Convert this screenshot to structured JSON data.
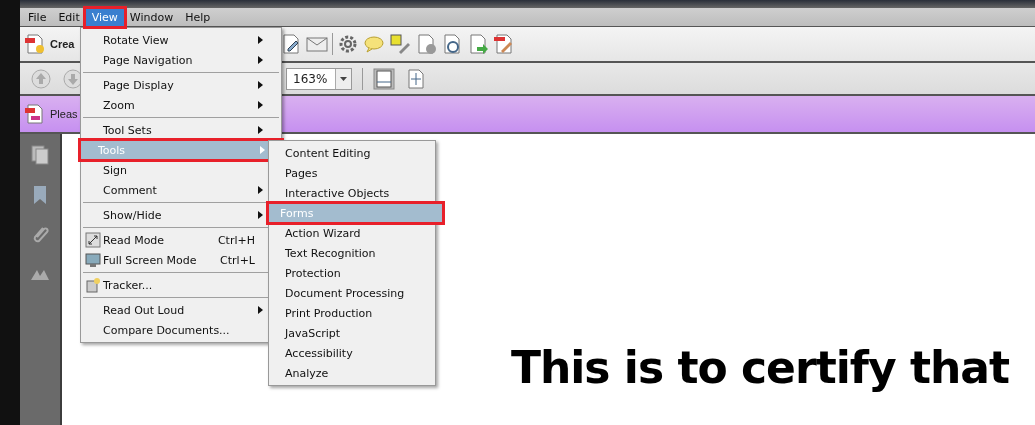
{
  "menubar": [
    {
      "label": "File",
      "selected": false,
      "outlined": false
    },
    {
      "label": "Edit",
      "selected": false,
      "outlined": false
    },
    {
      "label": "View",
      "selected": true,
      "outlined": true
    },
    {
      "label": "Window",
      "selected": false,
      "outlined": false
    },
    {
      "label": "Help",
      "selected": false,
      "outlined": false
    }
  ],
  "toolbar": {
    "create_label": "Crea",
    "zoom": "163%"
  },
  "notice": {
    "text": "Pleas"
  },
  "view_menu": [
    {
      "kind": "item",
      "label": "Rotate View",
      "submenu": true,
      "selected": false,
      "outlined": false
    },
    {
      "kind": "item",
      "label": "Page Navigation",
      "submenu": true,
      "selected": false,
      "outlined": false
    },
    {
      "kind": "separator"
    },
    {
      "kind": "item",
      "label": "Page Display",
      "submenu": true,
      "selected": false,
      "outlined": false
    },
    {
      "kind": "item",
      "label": "Zoom",
      "submenu": true,
      "selected": false,
      "outlined": false
    },
    {
      "kind": "separator"
    },
    {
      "kind": "item",
      "label": "Tool Sets",
      "submenu": true,
      "selected": false,
      "outlined": false
    },
    {
      "kind": "item",
      "label": "Tools",
      "submenu": true,
      "selected": true,
      "outlined": true
    },
    {
      "kind": "item",
      "label": "Sign",
      "submenu": false,
      "selected": false,
      "outlined": false
    },
    {
      "kind": "item",
      "label": "Comment",
      "submenu": true,
      "selected": false,
      "outlined": false
    },
    {
      "kind": "separator"
    },
    {
      "kind": "item",
      "label": "Show/Hide",
      "submenu": true,
      "selected": false,
      "outlined": false
    },
    {
      "kind": "separator"
    },
    {
      "kind": "icon_item",
      "label": "Read Mode",
      "shortcut": "Ctrl+H",
      "submenu": false,
      "selected": false,
      "outlined": false
    },
    {
      "kind": "icon_item",
      "label": "Full Screen Mode",
      "shortcut": "Ctrl+L",
      "submenu": false,
      "selected": false,
      "outlined": false
    },
    {
      "kind": "separator"
    },
    {
      "kind": "icon_item",
      "label": "Tracker...",
      "submenu": false,
      "selected": false,
      "outlined": false
    },
    {
      "kind": "separator"
    },
    {
      "kind": "item",
      "label": "Read Out Loud",
      "submenu": true,
      "selected": false,
      "outlined": false
    },
    {
      "kind": "item",
      "label": "Compare Documents...",
      "submenu": false,
      "selected": false,
      "outlined": false
    }
  ],
  "tools_menu": [
    {
      "label": "Content Editing",
      "selected": false,
      "outlined": false
    },
    {
      "label": "Pages",
      "selected": false,
      "outlined": false
    },
    {
      "label": "Interactive Objects",
      "selected": false,
      "outlined": false
    },
    {
      "label": "Forms",
      "selected": true,
      "outlined": true
    },
    {
      "label": "Action Wizard",
      "selected": false,
      "outlined": false
    },
    {
      "label": "Text Recognition",
      "selected": false,
      "outlined": false
    },
    {
      "label": "Protection",
      "selected": false,
      "outlined": false
    },
    {
      "label": "Document Processing",
      "selected": false,
      "outlined": false
    },
    {
      "label": "Print Production",
      "selected": false,
      "outlined": false
    },
    {
      "label": "JavaScript",
      "selected": false,
      "outlined": false
    },
    {
      "label": "Accessibility",
      "selected": false,
      "outlined": false
    },
    {
      "label": "Analyze",
      "selected": false,
      "outlined": false
    }
  ],
  "document": {
    "heading": "This is to certify that"
  }
}
